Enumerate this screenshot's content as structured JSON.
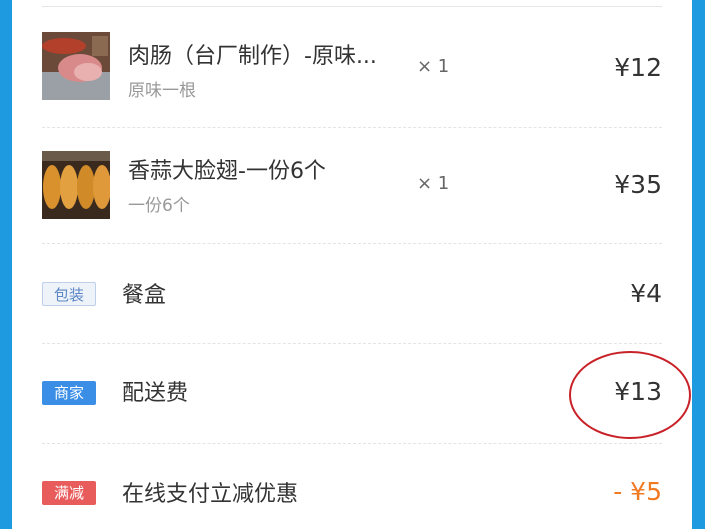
{
  "items": [
    {
      "title": "肉肠（台厂制作）-原味...",
      "subtitle": "原味一根",
      "qty": "× 1",
      "price": "¥12",
      "image_icon": "sausage-photo"
    },
    {
      "title": "香蒜大脸翅-一份6个",
      "subtitle": "一份6个",
      "qty": "× 1",
      "price": "¥35",
      "image_icon": "chicken-wings-photo"
    }
  ],
  "fees": [
    {
      "badge": "包装",
      "label": "餐盒",
      "amount": "¥4",
      "badge_color": "#eef3fa"
    },
    {
      "badge": "商家",
      "label": "配送费",
      "amount": "¥13",
      "badge_color": "#3a8ee6"
    },
    {
      "badge": "满减",
      "label": "在线支付立减优惠",
      "amount": "- ¥5",
      "badge_color": "#e85c5c",
      "amount_color": "#f07a24"
    }
  ],
  "colors": {
    "background": "#1e9be0",
    "highlight_circle": "#c82127"
  }
}
